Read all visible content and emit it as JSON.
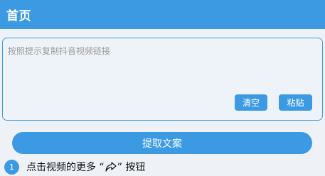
{
  "header": {
    "title": "首页"
  },
  "input": {
    "placeholder": "按照提示复制抖音视频链接",
    "value": ""
  },
  "buttons": {
    "clear_label": "清空",
    "paste_label": "粘贴",
    "extract_label": "提取文案"
  },
  "steps": [
    {
      "number": "1",
      "text_before": "点击视频的更多 “",
      "icon": "share-arrow-icon",
      "text_after": "” 按钮"
    }
  ],
  "colors": {
    "accent": "#3c9ae3",
    "background": "#eef2f7",
    "placeholder": "#9a9a9a",
    "text": "#111111"
  }
}
